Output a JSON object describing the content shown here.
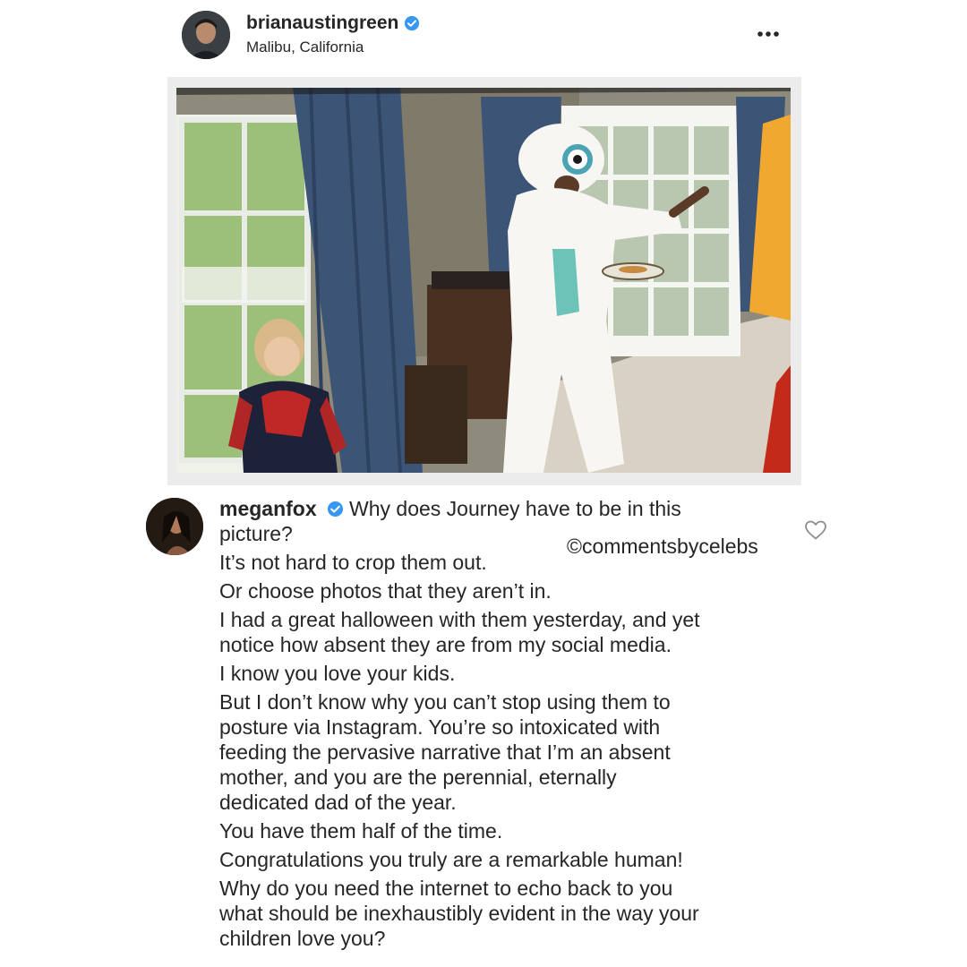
{
  "post": {
    "username": "brianaustingreen",
    "location": "Malibu, California",
    "verified": true,
    "more_icon": "more-horizontal-icon"
  },
  "photo": {
    "description_icon": "photo"
  },
  "comment": {
    "username": "meganfox",
    "verified": true,
    "lines": [
      "Why does Journey have to be in this",
      "picture?",
      "It’s not hard to crop them out.",
      "Or choose photos that they aren’t in.",
      "I had a great halloween with them yesterday, and yet",
      "notice how absent they are from my social media.",
      "I know you love your kids.",
      "But I don’t know why you can’t stop using them to",
      "posture via Instagram. You’re so intoxicated with",
      "feeding the pervasive narrative that I’m an absent",
      "mother, and you are the perennial, eternally",
      "dedicated dad of the year.",
      "You have them half of the time.",
      "Congratulations you truly are a remarkable human!",
      "Why do you need the internet to echo back to you",
      "what should be inexhaustibly evident in the way your",
      "children love you?"
    ],
    "heart_icon": "heart-outline-icon"
  },
  "watermark": "©commentsbycelebs",
  "colors": {
    "verified_blue": "#3897f0",
    "text": "#262626"
  }
}
